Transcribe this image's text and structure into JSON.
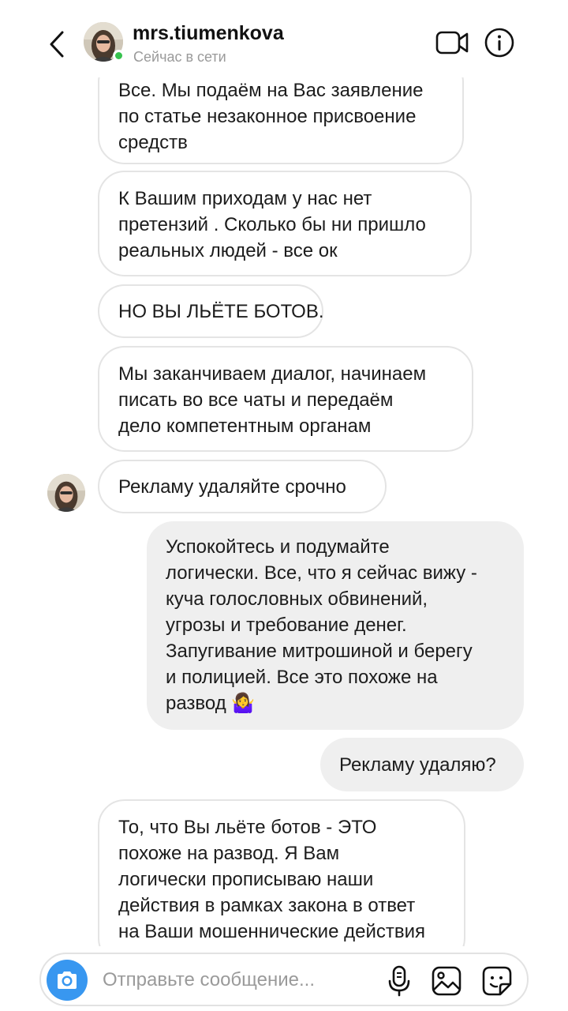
{
  "header": {
    "username": "mrs.tiumenkova",
    "status": "Сейчас в сети"
  },
  "messages": [
    {
      "from": "them",
      "lines": [
        "Все. Мы подаём на Вас заявление",
        "по статье незаконное присвоение",
        "средств"
      ]
    },
    {
      "from": "them",
      "lines": [
        "К Вашим приходам у нас нет",
        "претензий . Сколько бы ни пришло",
        "реальных людей - все ок"
      ]
    },
    {
      "from": "them",
      "lines": [
        "НО ВЫ ЛЬЁТЕ БОТОВ."
      ]
    },
    {
      "from": "them",
      "lines": [
        "Мы заканчиваем диалог, начинаем",
        "писать во все чаты и передаём",
        "дело компетентным органам"
      ]
    },
    {
      "from": "them",
      "lines": [
        "Рекламу удаляйте  срочно"
      ]
    },
    {
      "from": "me",
      "lines": [
        "Успокойтесь и подумайте",
        "логически. Все, что я сейчас вижу -",
        "куча голословных обвинений,",
        "угрозы и требование денег.",
        "Запугивание митрошиной и берегу",
        "и полицией. Все это похоже на",
        "развод 🤷‍♀️"
      ]
    },
    {
      "from": "me",
      "lines": [
        "Рекламу удаляю?"
      ]
    },
    {
      "from": "them",
      "lines": [
        "То, что Вы льёте ботов - ЭТО",
        "похоже на развод. Я Вам",
        "логически прописываю наши",
        "действия в рамках закона в ответ",
        "на Ваши мошеннические действия"
      ]
    }
  ],
  "composer": {
    "placeholder": "Отправьте сообщение..."
  },
  "colors": {
    "accent": "#3897f0",
    "online": "#37c24e",
    "outgoing_bubble": "#efefef",
    "incoming_border": "#e4e4e4"
  },
  "icons": [
    "back-chevron-icon",
    "video-call-icon",
    "info-icon",
    "camera-icon",
    "microphone-icon",
    "gallery-icon",
    "sticker-icon"
  ]
}
